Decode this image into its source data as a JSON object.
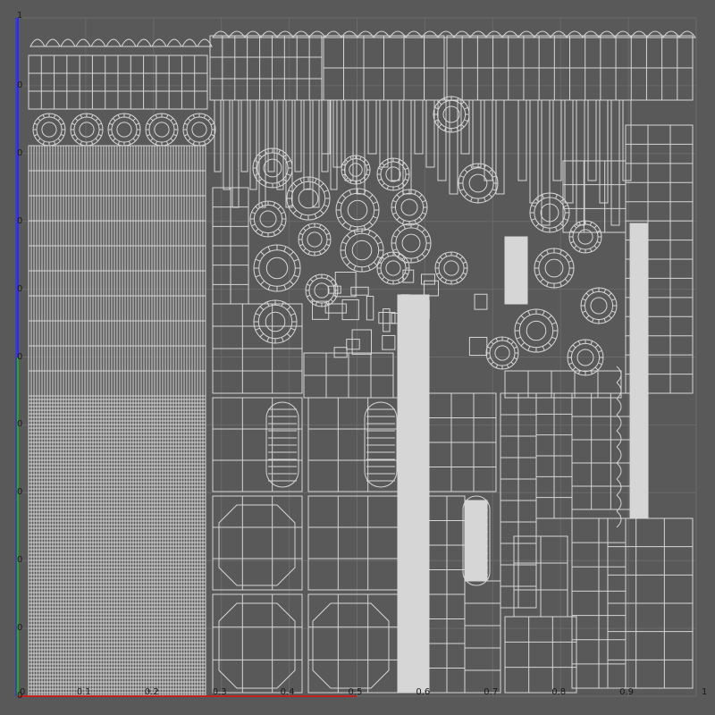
{
  "viewport": {
    "name": "UV Editor",
    "background": "#595959",
    "wire_color": "#d6d6d6",
    "grid_color": "#6a6a6a",
    "u_axis_color": "#c02020",
    "v_axis_color": "#2a2aff",
    "v_axis_lower_color": "#22aa22"
  },
  "axes": {
    "u_ticks": [
      "0",
      "0.1",
      "0.2",
      "0.3",
      "0.4",
      "0.5",
      "0.6",
      "0.7",
      "0.8",
      "0.9",
      "1"
    ],
    "v_ticks": [
      "0",
      "0",
      "0",
      "0",
      "0",
      "0",
      "0",
      "0",
      "0",
      "0",
      "1"
    ],
    "u_range": [
      0,
      1
    ],
    "v_range": [
      0,
      1
    ]
  }
}
